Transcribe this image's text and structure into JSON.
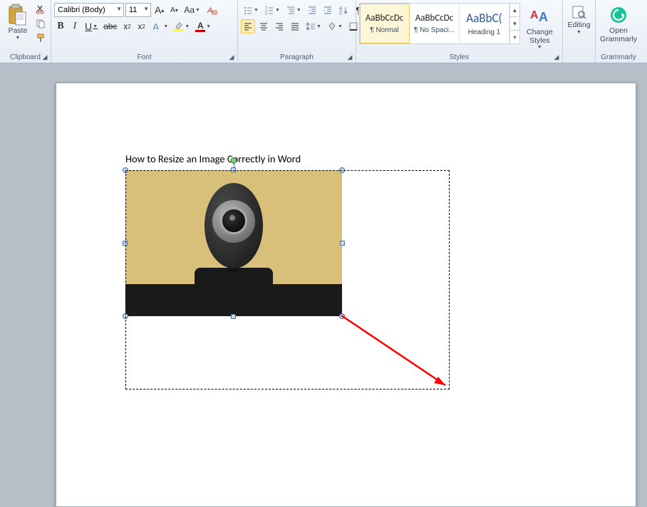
{
  "ribbon": {
    "clipboard": {
      "label": "Clipboard",
      "paste": "Paste",
      "cut_icon": "cut",
      "copy_icon": "copy",
      "format_painter_icon": "format-painter"
    },
    "font": {
      "label": "Font",
      "font_name": "Calibri (Body)",
      "font_size": "11",
      "bold": "B",
      "italic": "I",
      "underline": "U",
      "strike": "abc",
      "sub": "x",
      "sup": "x",
      "grow": "A",
      "shrink": "A",
      "case": "Aa",
      "clear": "A",
      "highlight_color": "#ffff00",
      "font_color": "#c00000"
    },
    "paragraph": {
      "label": "Paragraph"
    },
    "styles": {
      "label": "Styles",
      "items": [
        {
          "preview": "AaBbCcDc",
          "name": "¶ Normal",
          "selected": true,
          "color": "#000",
          "size": "13px"
        },
        {
          "preview": "AaBbCcDc",
          "name": "¶ No Spaci...",
          "selected": false,
          "color": "#000",
          "size": "13px"
        },
        {
          "preview": "AaBbC(",
          "name": "Heading 1",
          "selected": false,
          "color": "#2a5a9a",
          "size": "17px"
        }
      ],
      "change_styles": "Change\nStyles"
    },
    "editing": {
      "label": "Editing"
    },
    "grammarly": {
      "label": "Grammarly",
      "open": "Open\nGrammarly"
    }
  },
  "document": {
    "text": "How to Resize an Image Correctly in Word"
  }
}
